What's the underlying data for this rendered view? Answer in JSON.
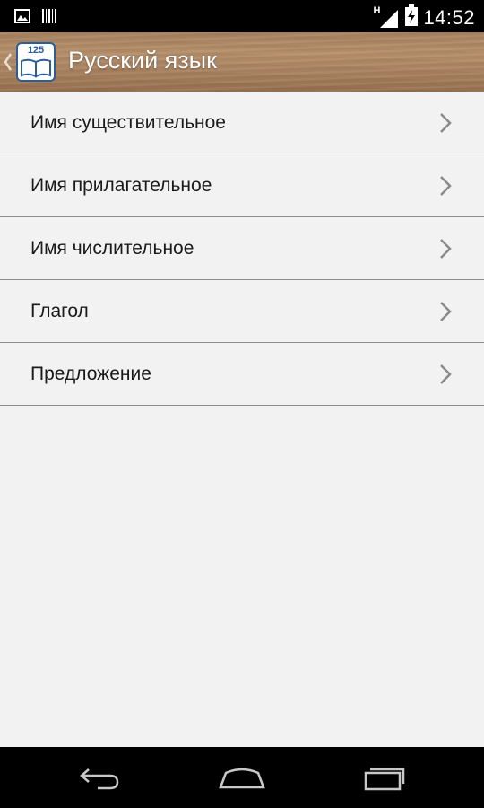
{
  "status_bar": {
    "time": "14:52",
    "network_type": "H",
    "icons": [
      "image-notification-icon",
      "barcode-notification-icon",
      "signal-icon",
      "battery-charging-icon"
    ]
  },
  "action_bar": {
    "title": "Русский язык",
    "app_icon_number": "125"
  },
  "menu": {
    "items": [
      {
        "label": "Имя существительное"
      },
      {
        "label": "Имя прилагательное"
      },
      {
        "label": "Имя числительное"
      },
      {
        "label": "Глагол"
      },
      {
        "label": "Предложение"
      }
    ]
  },
  "nav_bar": {
    "buttons": [
      "back-icon",
      "home-icon",
      "recents-icon"
    ]
  }
}
